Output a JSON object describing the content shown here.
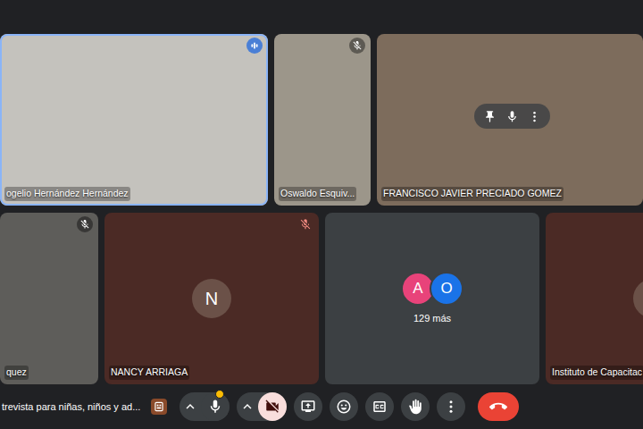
{
  "rows": [
    [
      {
        "name": "ogelio Hernández Hernández",
        "kind": "video",
        "muted": false,
        "speaking": true,
        "controls_shown": false
      },
      {
        "name": "Oswaldo Esquiv...",
        "kind": "video",
        "muted": true,
        "speaking": false,
        "controls_shown": false
      },
      {
        "name": "FRANCISCO JAVIER PRECIADO GOMEZ",
        "kind": "video",
        "muted": false,
        "speaking": false,
        "controls_shown": true
      }
    ],
    [
      {
        "name": "quez",
        "kind": "video",
        "muted": true,
        "speaking": false,
        "controls_shown": false
      },
      {
        "name": "NANCY ARRIAGA",
        "kind": "avatar",
        "initial": "N",
        "muted": true,
        "speaking": false,
        "controls_shown": false
      },
      {
        "name": "",
        "kind": "group",
        "avatars": [
          {
            "letter": "A",
            "color": "#e8437a"
          },
          {
            "letter": "O",
            "color": "#1a73e8"
          }
        ],
        "more": "129 más",
        "muted": false,
        "speaking": false,
        "controls_shown": false
      },
      {
        "name": "Instituto de Capacitac",
        "kind": "avatar",
        "initial": "",
        "muted": false,
        "speaking": false,
        "controls_shown": false
      }
    ]
  ],
  "toolbar": {
    "meeting_title": "trevista para niñas, niños y ad...",
    "controls": [
      {
        "kind": "activities",
        "highlighted": false,
        "warning": false
      },
      {
        "kind": "mic",
        "highlighted": false,
        "warning": true
      },
      {
        "kind": "camera",
        "highlighted": true,
        "warning": false
      },
      {
        "kind": "present",
        "highlighted": false,
        "warning": false
      },
      {
        "kind": "reactions",
        "highlighted": false,
        "warning": false
      },
      {
        "kind": "captions",
        "highlighted": false,
        "warning": false
      },
      {
        "kind": "hand",
        "highlighted": false,
        "warning": false
      },
      {
        "kind": "more",
        "highlighted": false,
        "warning": false
      },
      {
        "kind": "leave",
        "highlighted": false,
        "warning": false
      }
    ]
  }
}
